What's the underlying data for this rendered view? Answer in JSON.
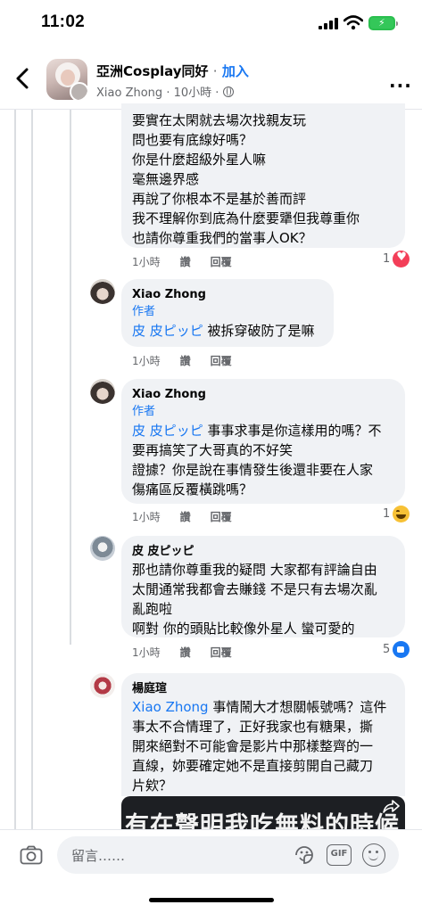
{
  "status_bar": {
    "time": "11:02"
  },
  "header": {
    "group_name": "亞洲Cosplay同好",
    "separator": "·",
    "join_label": "加入",
    "author": "Xiao Zhong",
    "time": "· 10小時 ·",
    "more": "···"
  },
  "comments": [
    {
      "author": "",
      "text": "要實在太閑就去場次找親友玩\n問也要有底線好嗎？\n你是什麼超級外星人嘛\n毫無邊界感\n再說了你根本不是基於善而評\n我不理解你到底為什麼要犟但我尊重你\n也請你尊重我們的當事人OK？",
      "time": "1小時",
      "like_label": "讚",
      "reply_label": "回覆",
      "reaction_count": "1",
      "reaction": "heart"
    },
    {
      "author": "Xiao Zhong",
      "badge": "作者",
      "mention": "皮 皮ピッピ",
      "text": " 被拆穿破防了是嘛",
      "time": "1小時",
      "like_label": "讚",
      "reply_label": "回覆"
    },
    {
      "author": "Xiao Zhong",
      "badge": "作者",
      "mention": "皮 皮ピッピ",
      "text": " 事事求事是你這樣用的嗎？不\n要再搞笑了大哥真的不好笑\n證據？你是說在事情發生後還非要在人家\n傷痛區反覆橫跳嗎？",
      "time": "1小時",
      "like_label": "讚",
      "reply_label": "回覆",
      "reaction_count": "1",
      "reaction": "haha"
    },
    {
      "author": "皮 皮ピッピ",
      "text": "那也請你尊重我的疑問 大家都有評論自由\n太閒通常我都會去賺錢 不是只有去場次亂\n亂跑啦\n啊對 你的頭貼比較像外星人 蠻可愛的",
      "time": "1小時",
      "like_label": "讚",
      "reply_label": "回覆",
      "reaction_count": "5",
      "reaction": "like"
    },
    {
      "author": "楊庭瑄",
      "mention": "Xiao Zhong",
      "text": " 事情鬧大才想關帳號嗎？這件\n事太不合情理了，正好我家也有糖果，撕\n開來絕對不可能會是影片中那樣整齊的一\n直線，妳要確定她不是直接剪開自己藏刀\n片欸？",
      "video_caption": "有在聲明我吃無料的時候"
    }
  ],
  "composer": {
    "placeholder": "留言……",
    "gif_label": "GIF"
  }
}
